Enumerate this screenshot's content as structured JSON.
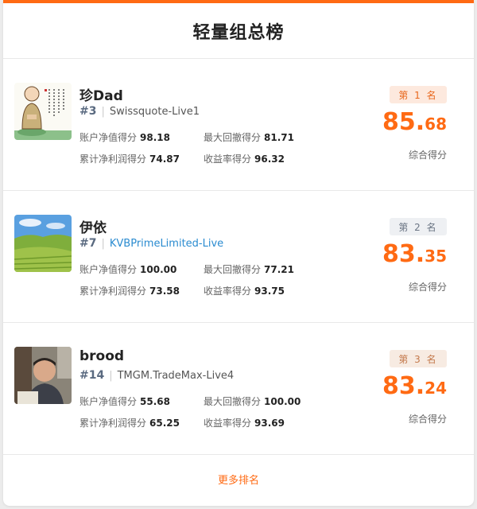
{
  "title": "轻量组总榜",
  "accent": "#ff6a13",
  "entries": [
    {
      "name": "珍Dad",
      "rank_no": "#3",
      "server": "Swissquote-Live1",
      "stats": {
        "equity_label": "账户净值得分",
        "equity": "98.18",
        "drawdown_label": "最大回撤得分",
        "drawdown": "81.71",
        "profit_label": "累计净利润得分",
        "profit": "74.87",
        "yield_label": "收益率得分",
        "yield": "96.32"
      },
      "badge": "第 1 名",
      "score_int": "85.",
      "score_dec": "68",
      "score_label": "综合得分"
    },
    {
      "name": "伊依",
      "rank_no": "#7",
      "server": "KVBPrimeLimited-Live",
      "stats": {
        "equity_label": "账户净值得分",
        "equity": "100.00",
        "drawdown_label": "最大回撤得分",
        "drawdown": "77.21",
        "profit_label": "累计净利润得分",
        "profit": "73.58",
        "yield_label": "收益率得分",
        "yield": "93.75"
      },
      "badge": "第 2 名",
      "score_int": "83.",
      "score_dec": "35",
      "score_label": "综合得分"
    },
    {
      "name": "brood",
      "rank_no": "#14",
      "server": "TMGM.TradeMax-Live4",
      "stats": {
        "equity_label": "账户净值得分",
        "equity": "55.68",
        "drawdown_label": "最大回撤得分",
        "drawdown": "100.00",
        "profit_label": "累计净利润得分",
        "profit": "65.25",
        "yield_label": "收益率得分",
        "yield": "93.69"
      },
      "badge": "第 3 名",
      "score_int": "83.",
      "score_dec": "24",
      "score_label": "综合得分"
    }
  ],
  "more_label": "更多排名"
}
